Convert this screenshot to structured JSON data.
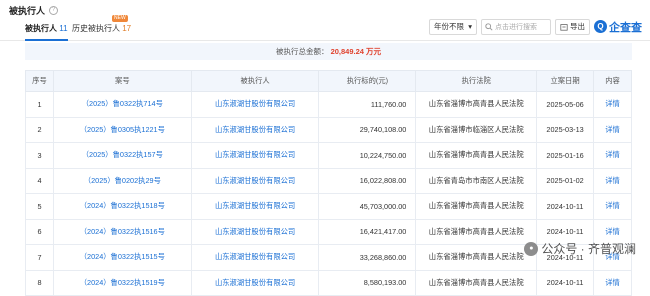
{
  "header": {
    "title": "被执行人",
    "help": "?"
  },
  "tabs": [
    {
      "label": "被执行人",
      "count": "11",
      "active": true
    },
    {
      "label": "历史被执行人",
      "count": "17",
      "badge": "NEW"
    }
  ],
  "toolbar": {
    "year_select": "年份不限",
    "year_arrow": "▾",
    "search_placeholder": "点击进行搜索",
    "export_label": "导出",
    "logo_text": "企查查",
    "logo_mark": "Q"
  },
  "summary": {
    "label": "被执行总金额：",
    "amount": "20,849.24",
    "unit": "万元"
  },
  "table": {
    "columns": [
      "序号",
      "案号",
      "被执行人",
      "执行标的(元)",
      "执行法院",
      "立案日期",
      "内容"
    ],
    "rows": [
      {
        "no": "1",
        "case": "（2025）鲁0322执714号",
        "party": "山东淑湖甘股份有限公司",
        "amount": "111,760.00",
        "court": "山东省淄博市高青县人民法院",
        "date": "2025-05-06",
        "action": "详情"
      },
      {
        "no": "2",
        "case": "（2025）鲁0305执1221号",
        "party": "山东淑湖甘股份有限公司",
        "amount": "29,740,108.00",
        "court": "山东省淄博市临淄区人民法院",
        "date": "2025-03-13",
        "action": "详情"
      },
      {
        "no": "3",
        "case": "（2025）鲁0322执157号",
        "party": "山东淑湖甘股份有限公司",
        "amount": "10,224,750.00",
        "court": "山东省淄博市高青县人民法院",
        "date": "2025-01-16",
        "action": "详情"
      },
      {
        "no": "4",
        "case": "（2025）鲁0202执29号",
        "party": "山东淑湖甘股份有限公司",
        "amount": "16,022,808.00",
        "court": "山东省青岛市市南区人民法院",
        "date": "2025-01-02",
        "action": "详情"
      },
      {
        "no": "5",
        "case": "（2024）鲁0322执1518号",
        "party": "山东淑湖甘股份有限公司",
        "amount": "45,703,000.00",
        "court": "山东省淄博市高青县人民法院",
        "date": "2024-10-11",
        "action": "详情"
      },
      {
        "no": "6",
        "case": "（2024）鲁0322执1516号",
        "party": "山东淑湖甘股份有限公司",
        "amount": "16,421,417.00",
        "court": "山东省淄博市高青县人民法院",
        "date": "2024-10-11",
        "action": "详情"
      },
      {
        "no": "7",
        "case": "（2024）鲁0322执1515号",
        "party": "山东淑湖甘股份有限公司",
        "amount": "33,268,860.00",
        "court": "山东省淄博市高青县人民法院",
        "date": "2024-10-11",
        "action": "详情"
      },
      {
        "no": "8",
        "case": "（2024）鲁0322执1519号",
        "party": "山东淑湖甘股份有限公司",
        "amount": "8,580,193.00",
        "court": "山东省淄博市高青县人民法院",
        "date": "2024-10-11",
        "action": "详情"
      }
    ]
  },
  "watermark": {
    "text": "公众号 · 齐普观澜"
  },
  "colors": {
    "accent": "#1a6fd4",
    "amount": "#e0422e",
    "badge": "#f0883a"
  }
}
